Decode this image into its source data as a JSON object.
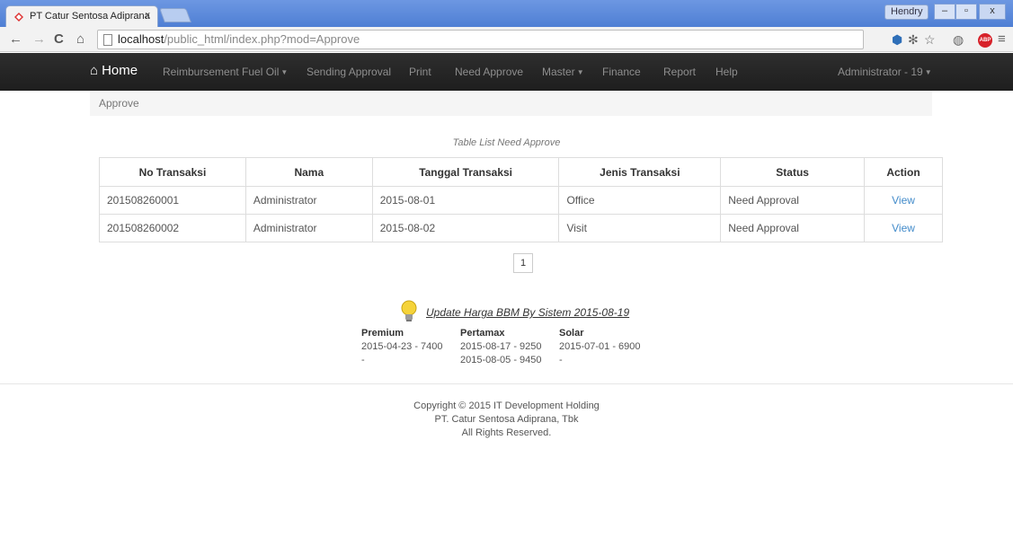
{
  "browser": {
    "tab_title": "PT Catur Sentosa Adiprana",
    "tab_close": "x",
    "user_badge": "Hendry",
    "win_min": "–",
    "win_max": "▫",
    "win_close": "x",
    "url_host": "localhost",
    "url_path": "/public_html/index.php?mod=Approve"
  },
  "navbar": {
    "brand": "Home",
    "items": [
      {
        "label": "Reimbursement Fuel Oil",
        "dropdown": true
      },
      {
        "label": "Sending Approval",
        "dropdown": false
      },
      {
        "label": "Print",
        "dropdown": false
      },
      {
        "label": "Need Approve",
        "dropdown": false
      },
      {
        "label": "Master",
        "dropdown": true
      },
      {
        "label": "Finance",
        "dropdown": false
      },
      {
        "label": "Report",
        "dropdown": false
      },
      {
        "label": "Help",
        "dropdown": false
      }
    ],
    "user_menu": "Administrator - 19"
  },
  "breadcrumb": "Approve",
  "table": {
    "caption": "Table List Need Approve",
    "headers": [
      "No Transaksi",
      "Nama",
      "Tanggal Transaksi",
      "Jenis Transaksi",
      "Status",
      "Action"
    ],
    "rows": [
      [
        "201508260001",
        "Administrator",
        "2015-08-01",
        "Office",
        "Need Approval",
        "View"
      ],
      [
        "201508260002",
        "Administrator",
        "2015-08-02",
        "Visit",
        "Need Approval",
        "View"
      ]
    ]
  },
  "pagination": "1",
  "fuel": {
    "title": "Update Harga BBM By Sistem 2015-08-19",
    "columns": [
      {
        "header": "Premium",
        "lines": [
          "2015-04-23 - 7400",
          "-"
        ]
      },
      {
        "header": "Pertamax",
        "lines": [
          "2015-08-17 - 9250",
          "2015-08-05 - 9450"
        ]
      },
      {
        "header": "Solar",
        "lines": [
          "2015-07-01 - 6900",
          "-"
        ]
      }
    ]
  },
  "footer": {
    "line1": "Copyright © 2015 IT Development Holding",
    "line2": "PT. Catur Sentosa Adiprana, Tbk",
    "line3": "All Rights Reserved."
  },
  "colors": {
    "navbar": "#222222",
    "link": "#428bca",
    "titlebar": "#5a86d6"
  }
}
